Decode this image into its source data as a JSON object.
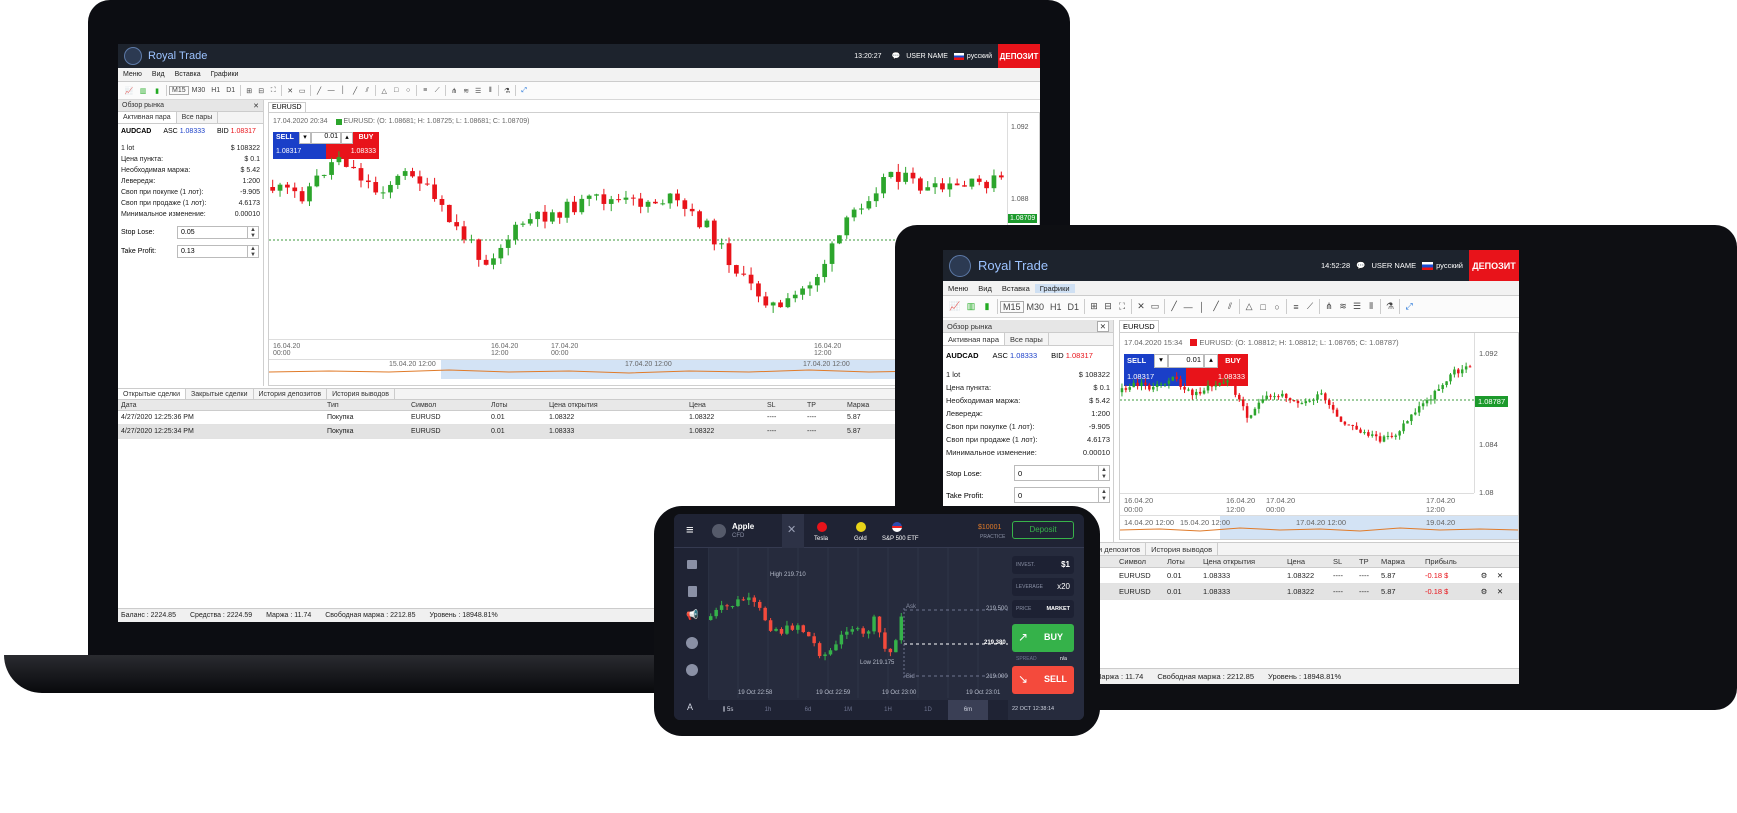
{
  "brand": {
    "name": "Royal Trade",
    "deposit": "ДЕПОЗИТ",
    "user_name": "USER NAME",
    "language": "русский"
  },
  "colors": {
    "header_bg": "#1d232d",
    "deposit_red": "#e8131a",
    "sell_blue": "#1a3fc8",
    "candle_up": "#2ca52c",
    "candle_down": "#e8131a",
    "mobile_bg": "#262b3d"
  },
  "laptop": {
    "time": "13:20:27",
    "menu": [
      "Меню",
      "Вид",
      "Вставка",
      "Графики"
    ],
    "timeframes": [
      "M15",
      "M30",
      "H1",
      "D1"
    ],
    "market_title": "Обзор рынка",
    "tabs": [
      "Активная пара",
      "Все пары"
    ],
    "pair": "AUDCAD",
    "asc_label": "ASC",
    "asc_value": "1.08333",
    "bid_label": "BID",
    "bid_value": "1.08317",
    "details": [
      {
        "label": "1 lot",
        "value": "$ 108322"
      },
      {
        "label": "Цена пункта:",
        "value": "$ 0.1"
      },
      {
        "label": "Необходимая маржа:",
        "value": "$ 5.42"
      },
      {
        "label": "Левередж:",
        "value": "1:200"
      },
      {
        "label": "Своп при покупке (1 лот):",
        "value": "-9.905"
      },
      {
        "label": "Своп при продаже (1 лот):",
        "value": "4.6173"
      },
      {
        "label": "Минимальное изменение:",
        "value": "0.00010"
      }
    ],
    "stop_loss_label": "Stop Lose:",
    "stop_loss_value": "0.05",
    "take_profit_label": "Take Profit:",
    "take_profit_value": "0.13",
    "chart_tab": "EURUSD",
    "chart_info": "17.04.2020 20:34",
    "chart_ohlc": "EURUSD: (O: 1.08681; H: 1.08725; L: 1.08681; C: 1.08709)",
    "sell_label": "SELL",
    "buy_label": "BUY",
    "lot": "0.01",
    "sell_price": "1.08317",
    "buy_price": "1.08333",
    "price_labels": [
      "1.092",
      "1.088",
      "1.08709"
    ],
    "time_labels": [
      "16.04.20\n00:00",
      "16.04.20\n12:00",
      "17.04.20\n00:00",
      "16.04.20\n12:00"
    ],
    "nav_labels": [
      "15.04.20 12:00",
      "17.04.20 12:00",
      "17.04.20 12:00"
    ],
    "bottom_tabs": [
      "Открытые сделки",
      "Закрытые сделки",
      "История депозитов",
      "История выводов"
    ],
    "columns": [
      "Дата",
      "Тип",
      "Символ",
      "Лоты",
      "Цена открытия",
      "Цена",
      "SL",
      "TP",
      "Маржа"
    ],
    "rows": [
      [
        "4/27/2020 12:25:36 PM",
        "Покупка",
        "EURUSD",
        "0.01",
        "1.08322",
        "1.08322",
        "----",
        "----",
        "5.87"
      ],
      [
        "4/27/2020 12:25:34 PM",
        "Покупка",
        "EURUSD",
        "0.01",
        "1.08333",
        "1.08322",
        "----",
        "----",
        "5.87"
      ]
    ],
    "status": [
      "Баланс : 2224.85",
      "Средства : 2224.59",
      "Маржа : 11.74",
      "Свободная маржа : 2212.85",
      "Уровень : 18948.81%"
    ]
  },
  "tablet": {
    "time": "14:52:28",
    "menu": [
      "Меню",
      "Вид",
      "Вставка",
      "Графики"
    ],
    "timeframes": [
      "M15",
      "M30",
      "H1",
      "D1"
    ],
    "market_title": "Обзор рынка",
    "tabs": [
      "Активная пара",
      "Все пары"
    ],
    "pair": "AUDCAD",
    "asc_label": "ASC",
    "asc_value": "1.08333",
    "bid_label": "BID",
    "bid_value": "1.08317",
    "details": [
      {
        "label": "1 lot",
        "value": "$ 108322"
      },
      {
        "label": "Цена пункта:",
        "value": "$ 0.1"
      },
      {
        "label": "Необходимая маржа:",
        "value": "$ 5.42"
      },
      {
        "label": "Левередж:",
        "value": "1:200"
      },
      {
        "label": "Своп при покупке (1 лот):",
        "value": "-9.905"
      },
      {
        "label": "Своп при продаже (1 лот):",
        "value": "4.6173"
      },
      {
        "label": "Минимальное изменение:",
        "value": "0.00010"
      }
    ],
    "stop_loss_label": "Stop Lose:",
    "stop_loss_value": "0",
    "take_profit_label": "Take Profit:",
    "take_profit_value": "0",
    "chart_tab": "EURUSD",
    "chart_info": "17.04.2020 15:34",
    "chart_ohlc": "EURUSD: (O: 1.08812; H: 1.08812; L: 1.08765; C: 1.08787)",
    "sell_label": "SELL",
    "buy_label": "BUY",
    "lot": "0.01",
    "sell_price": "1.08317",
    "buy_price": "1.08333",
    "price_labels": [
      "1.092",
      "1.08787",
      "1.084",
      "1.08"
    ],
    "time_labels": [
      "16.04.20\n00:00",
      "16.04.20\n12:00",
      "17.04.20\n00:00",
      "17.04.20\n12:00"
    ],
    "nav_labels": [
      "14.04.20 12:00",
      "15.04.20 12:00",
      "17.04.20 12:00",
      "19.04.20"
    ],
    "bottom_tabs_visible": [
      "и депозитов",
      "История выводов"
    ],
    "columns": [
      "Символ",
      "Лоты",
      "Цена открытия",
      "Цена",
      "SL",
      "TP",
      "Маржа",
      "Прибыль"
    ],
    "rows": [
      [
        "EURUSD",
        "0.01",
        "1.08333",
        "1.08322",
        "----",
        "----",
        "5.87",
        "-0.18 $"
      ],
      [
        "EURUSD",
        "0.01",
        "1.08333",
        "1.08322",
        "----",
        "----",
        "5.87",
        "-0.18 $"
      ]
    ],
    "status": [
      "Маржа : 11.74",
      "Свободная маржа : 2212.85",
      "Уровень : 18948.81%"
    ]
  },
  "mobile": {
    "asset_name": "Apple",
    "asset_type": "CFD",
    "assets": [
      "Tesla",
      "Gold",
      "S&P 500 ETF"
    ],
    "balance": "$10001",
    "balance_mode": "PRACTICE",
    "deposit": "Deposit",
    "invest_label": "INVEST.",
    "invest_value": "$1",
    "leverage_label": "LEVERAGE",
    "leverage_value": "x20",
    "price_label": "PRICE",
    "price_value": "MARKET",
    "buy": "BUY",
    "sell": "SELL",
    "spread_label": "SPREAD",
    "spread_value": "n/a",
    "high_label": "High 219.710",
    "low_label": "Low 219.175",
    "ask": "Ask",
    "bid": "Bid",
    "price_ticks": [
      "219.500",
      "219.380",
      "219.000"
    ],
    "time_ticks": [
      "19 Oct 22:58",
      "19 Oct 22:59",
      "19 Oct 23:00",
      "19 Oct 23:01"
    ],
    "timeframes": [
      "5s",
      "1h",
      "6d",
      "1M",
      "1H",
      "1D",
      "6m"
    ],
    "date": "22 OCT 12:38:14"
  }
}
